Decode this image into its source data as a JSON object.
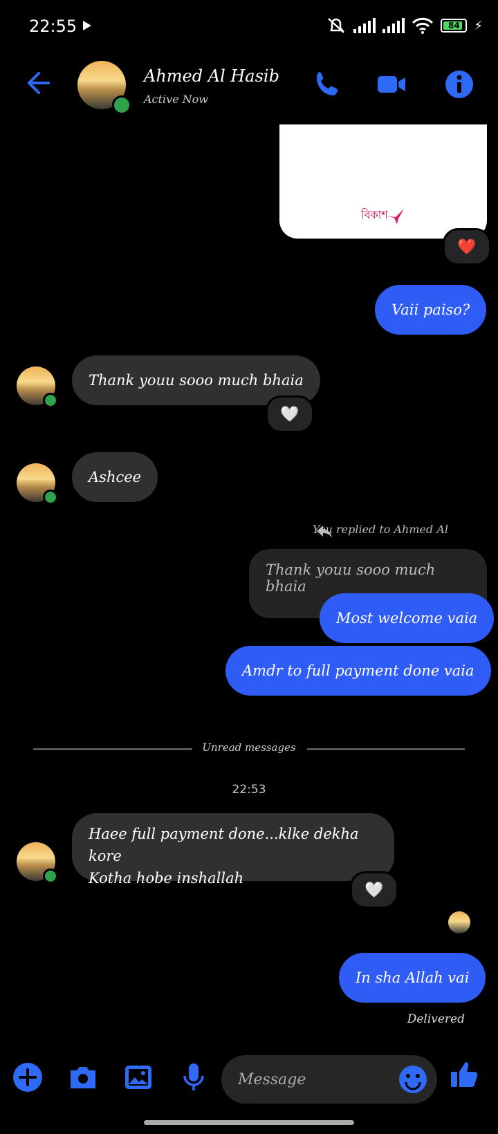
{
  "status_bar": {
    "time": "22:55",
    "battery": "84"
  },
  "header": {
    "name": "Ahmed Al Hasib",
    "status": "Active Now"
  },
  "image_card": {
    "brand": "বিকাশ"
  },
  "messages": {
    "m1": "Vaii paiso?",
    "m2": "Thank youu sooo much bhaia",
    "m3": "Ashcee",
    "replied_label": "You replied to Ahmed Al",
    "quoted": "Thank youu sooo much bhaia",
    "m4": "Most welcome vaia",
    "m5": "Amdr to full payment done vaia",
    "unread": "Unread messages",
    "time": "22:53",
    "m6_line1": "Haee full payment done...klke dekha kore",
    "m6_line2": "Kotha hobe inshallah",
    "m7": "In sha Allah vai",
    "delivered": "Delivered"
  },
  "reactions": {
    "heart_red": "❤️",
    "heart_white": "🤍"
  },
  "composer": {
    "placeholder": "Message"
  },
  "colors": {
    "accent": "#2f5cf5",
    "online": "#31a24c",
    "incoming": "#303030"
  }
}
